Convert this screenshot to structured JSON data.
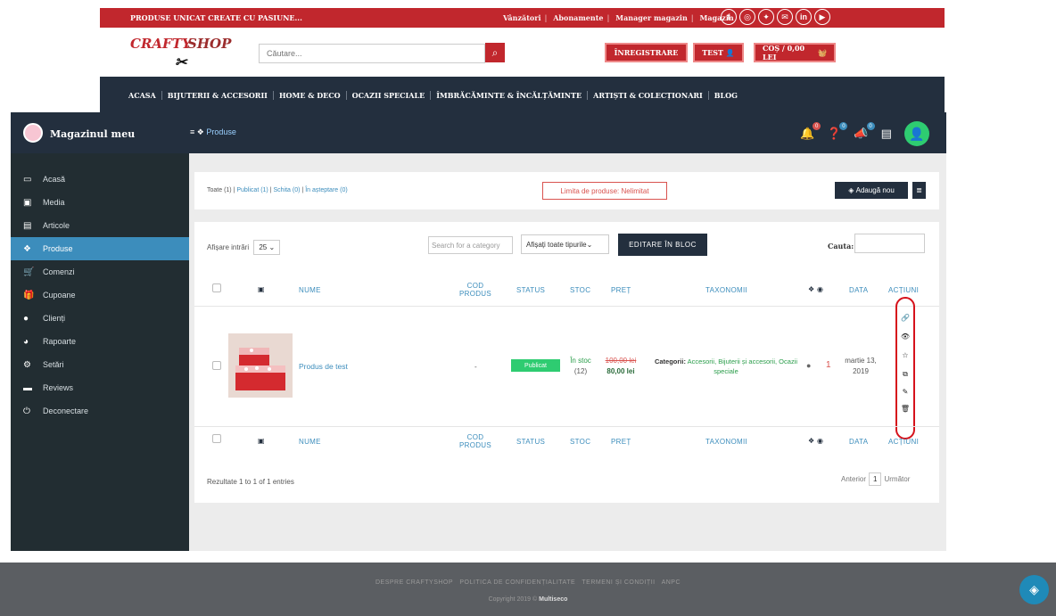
{
  "topbar": {
    "promo": "PRODUSE UNICAT CREATE CU PASIUNE...",
    "links": [
      "Vânzători",
      "Abonamente",
      "Manager magazin",
      "Magazin"
    ],
    "social_icons": [
      "facebook-icon",
      "instagram-icon",
      "twitter-icon",
      "email-icon",
      "linkedin-icon",
      "youtube-icon"
    ]
  },
  "header": {
    "logo_text_1": "CRAFTY",
    "logo_text_2": "SHOP",
    "search_placeholder": "Căutare...",
    "register_label": "ÎNREGISTRARE",
    "user_label": "TEST",
    "cart_label": "COȘ / 0,00 LEI"
  },
  "nav": {
    "items": [
      "ACASA",
      "BIJUTERII & ACCESORII",
      "HOME & DECO",
      "OCAZII SPECIALE",
      "ÎMBRĂCĂMINTE & ÎNCĂLȚĂMINTE",
      "ARTIȘTI & COLECȚIONARI",
      "BLOG"
    ]
  },
  "sidebar": {
    "title": "Magazinul meu",
    "items": [
      {
        "label": "Acasă",
        "icon": "monitor-icon"
      },
      {
        "label": "Media",
        "icon": "image-icon"
      },
      {
        "label": "Articole",
        "icon": "document-icon"
      },
      {
        "label": "Produse",
        "icon": "cubes-icon",
        "active": true
      },
      {
        "label": "Comenzi",
        "icon": "cart-icon"
      },
      {
        "label": "Cupoane",
        "icon": "gift-icon"
      },
      {
        "label": "Clienți",
        "icon": "user-icon"
      },
      {
        "label": "Rapoarte",
        "icon": "pie-chart-icon"
      },
      {
        "label": "Setări",
        "icon": "gears-icon"
      },
      {
        "label": "Reviews",
        "icon": "comment-icon"
      },
      {
        "label": "Deconectare",
        "icon": "power-icon"
      }
    ]
  },
  "dash_header": {
    "breadcrumb": "Produse",
    "notif_badges": [
      "0",
      "0",
      "0"
    ]
  },
  "filters_card": {
    "filter_all": "Toate (1)",
    "filter_published": "Publicat (1)",
    "filter_draft": "Schita (0)",
    "filter_pending": "În așteptare (0)",
    "sep": "|",
    "limit_label": "Limita de produse: Nelimitat",
    "add_new_label": "Adaugă nou"
  },
  "table_card": {
    "show_label": "Afișare intrări",
    "show_value": "25",
    "category_placeholder": "Search for a category",
    "type_select": "Afișați toate tipurile",
    "bulk_edit_label": "EDITARE ÎN BLOC",
    "search_label": "Cauta:",
    "columns": {
      "name": "NUME",
      "code_1": "COD",
      "code_2": "PRODUS",
      "status": "STATUS",
      "stock": "STOC",
      "price": "PREȚ",
      "taxonomy": "TAXONOMII",
      "date": "DATA",
      "actions": "ACȚIUNI"
    },
    "row": {
      "name": "Produs de test",
      "code": "-",
      "status": "Publicat",
      "stock_status": "În stoc",
      "stock_count": "(12)",
      "old_price": "100,00 lei",
      "price": "80,00 lei",
      "taxonomy_label": "Categorii:",
      "taxonomy_value": "Accesorii, Bijuterii și accesorii, Ocazii speciale",
      "views": "1",
      "date_1": "martie 13,",
      "date_2": "2019"
    },
    "results": "Rezultate 1 to 1 of 1 entries",
    "prev": "Anterior",
    "page": "1",
    "next": "Următor"
  },
  "footer": {
    "links": [
      "DESPRE CRAFTYSHOP",
      "POLITICA DE CONFIDENȚIALITATE",
      "TERMENI ȘI CONDIȚII",
      "ANPC"
    ],
    "copyright": "Copyright 2019 ©",
    "brand": "Multiseco"
  },
  "colors": {
    "brand_red": "#c1272d",
    "dark_navy": "#232f3e",
    "accent_blue": "#3c8dbc",
    "green": "#2ecc71"
  }
}
